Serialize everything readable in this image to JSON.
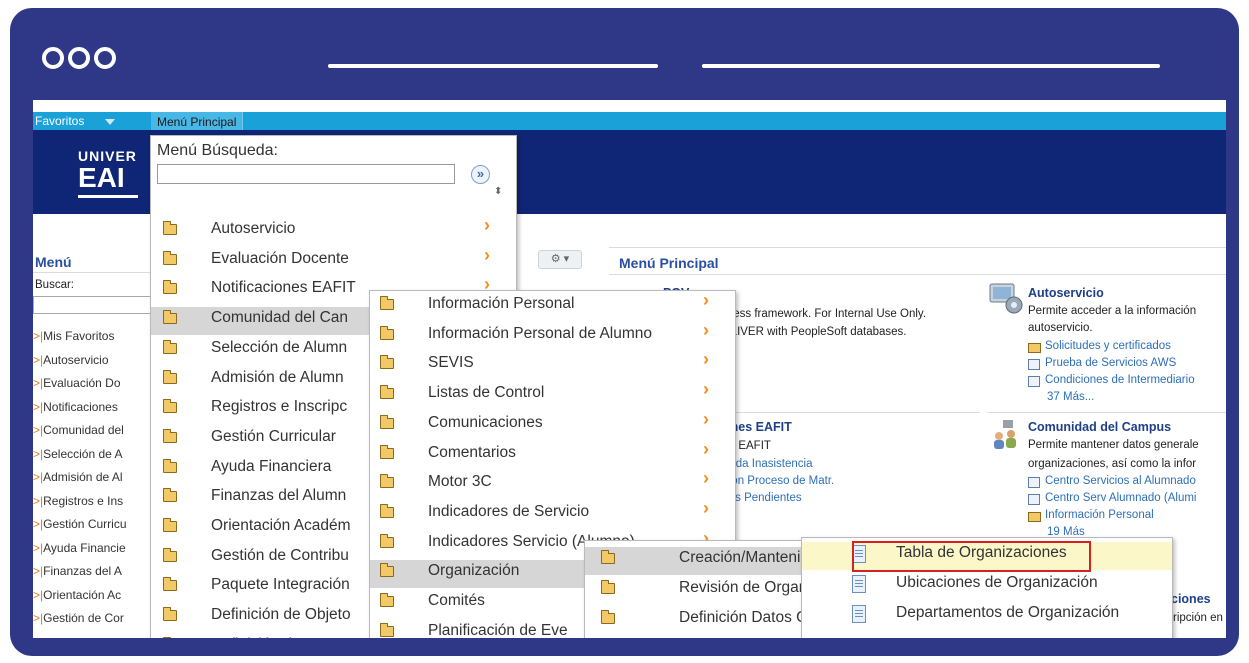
{
  "top_nav": {
    "favorites": "Favoritos",
    "main_menu": "Menú Principal"
  },
  "logo": {
    "line1": "UNIVER",
    "line2": "EAI"
  },
  "left_panel": {
    "title": "Menú",
    "search_label": "Buscar:",
    "links": [
      "Mis Favoritos",
      "Autoservicio",
      "Evaluación Do",
      "Notificaciones",
      "Comunidad del",
      "Selección de A",
      "Admisión de Al",
      "Registros e Ins",
      "Gestión Curricu",
      "Ayuda Financie",
      "Finanzas del A",
      "Orientación Ac",
      "Gestión de Cor"
    ]
  },
  "gear": "⚙ ▾",
  "main_panel": {
    "title": "Menú Principal",
    "frag_title": "POV.....",
    "frag_lines": [
      "rness framework. For Internal Use Only.",
      "ELIVER with PeopleSoft databases."
    ],
    "notif": {
      "title": "ones EAFIT",
      "line1": "es EAFIT",
      "links": [
        "rdida Inasistencia",
        "ción Proceso de Matr.",
        "itos Pendientes"
      ]
    },
    "autoservicio": {
      "title": "Autoservicio",
      "desc1": "Permite acceder a la información",
      "desc2": "autoservicio.",
      "links": [
        "Solicitudes y certificados",
        "Prueba de Servicios AWS",
        "Condiciones de Intermediario"
      ],
      "more": "37 Más..."
    },
    "comunidad": {
      "title": "Comunidad del Campus",
      "desc1": "Permite mantener datos generale",
      "desc2": "organizaciones, así como la infor",
      "links": [
        "Centro Servicios al Alumnado",
        "Centro Serv Alumnado (Alumi",
        "Información Personal"
      ],
      "more": "19 Más"
    },
    "corner_title": "ciones",
    "corner_desc": "ripción en"
  },
  "menu1": {
    "search_label": "Menú Búsqueda:",
    "search_value": "",
    "go": "»",
    "items": [
      "Autoservicio",
      "Evaluación Docente",
      "Notificaciones EAFIT",
      "Comunidad del Can",
      "Selección de Alumn",
      "Admisión de Alumn",
      "Registros e Inscripc",
      "Gestión Curricular",
      "Ayuda Financiera",
      "Finanzas del Alumn",
      "Orientación Académ",
      "Gestión de Contribu",
      "Paquete Integración",
      "Definición de Objeto",
      "Definición de SACR"
    ]
  },
  "menu2": {
    "items": [
      "Información Personal",
      "Información Personal de Alumno",
      "SEVIS",
      "Listas de Control",
      "Comunicaciones",
      "Comentarios",
      "Motor 3C",
      "Indicadores de Servicio",
      "Indicadores Servicio (Alumno)",
      "Organización",
      "Comités",
      "Planificación de Eve"
    ]
  },
  "menu3": {
    "items": [
      "Creación/Mantenim",
      "Revisión de Organiz",
      "Definición Datos Or"
    ]
  },
  "menu4": {
    "items": [
      "Tabla de Organizaciones",
      "Ubicaciones de Organización",
      "Departamentos de Organización"
    ]
  },
  "colors": {
    "frame": "#2f3886",
    "nav": "#19a1d8",
    "banner": "#0f2677",
    "highlight": "#d52121"
  }
}
